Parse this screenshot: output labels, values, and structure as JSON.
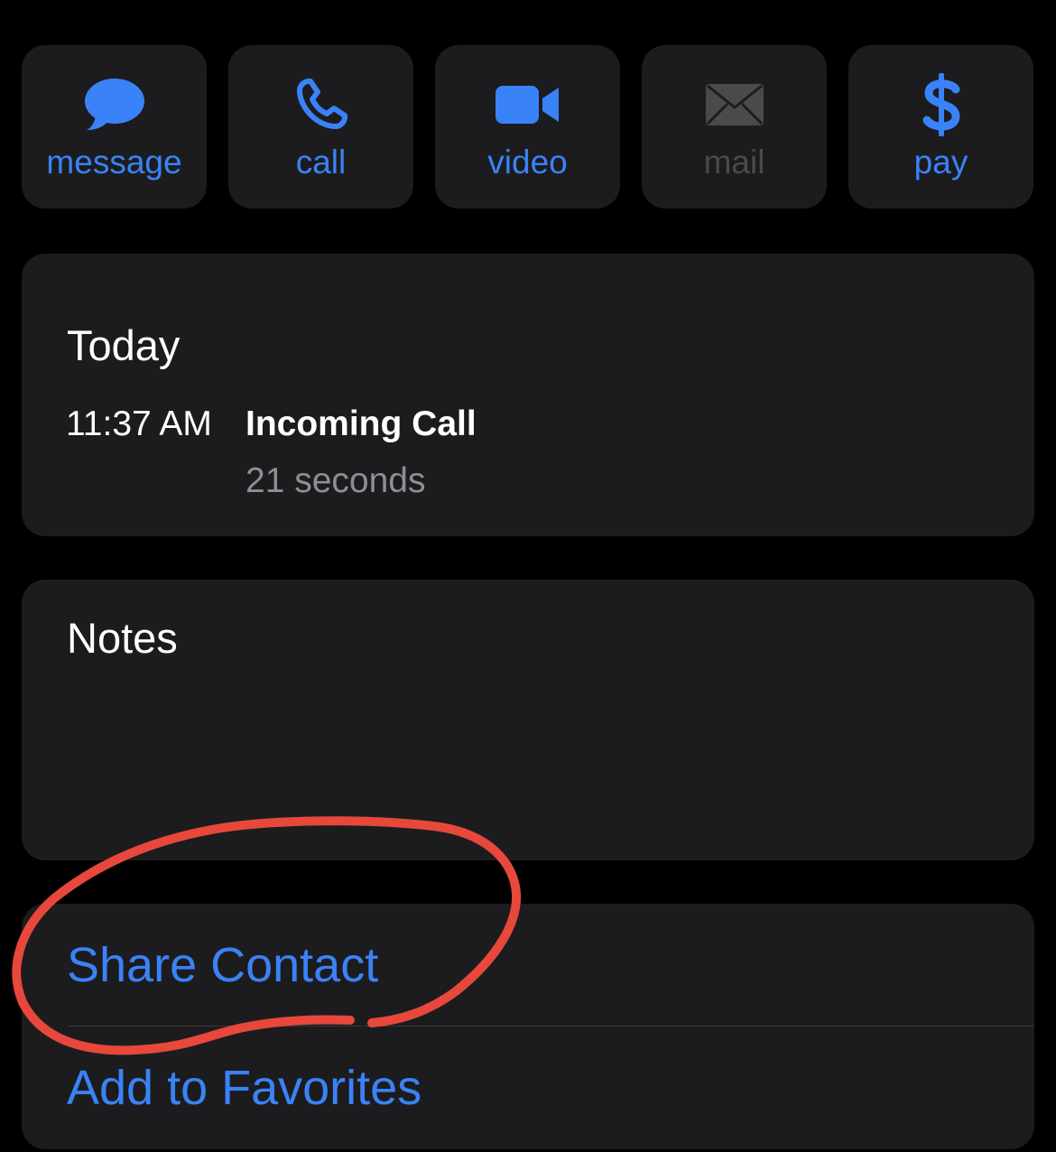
{
  "actions": [
    {
      "label": "message",
      "icon": "message-bubble-icon",
      "enabled": true
    },
    {
      "label": "call",
      "icon": "phone-icon",
      "enabled": true
    },
    {
      "label": "video",
      "icon": "video-camera-icon",
      "enabled": true
    },
    {
      "label": "mail",
      "icon": "envelope-icon",
      "enabled": false
    },
    {
      "label": "pay",
      "icon": "dollar-sign-icon",
      "enabled": true
    }
  ],
  "recents": {
    "heading": "Today",
    "time": "11:37 AM",
    "type": "Incoming Call",
    "duration": "21 seconds"
  },
  "notes": {
    "heading": "Notes"
  },
  "contact_actions": {
    "share": "Share Contact",
    "favorites": "Add to Favorites"
  },
  "colors": {
    "background": "#000000",
    "card": "#1c1c1e",
    "accent": "#3a82f7",
    "disabled": "#4a4a4d",
    "secondary_text": "#8e8e93",
    "annotation": "#e8473b"
  }
}
